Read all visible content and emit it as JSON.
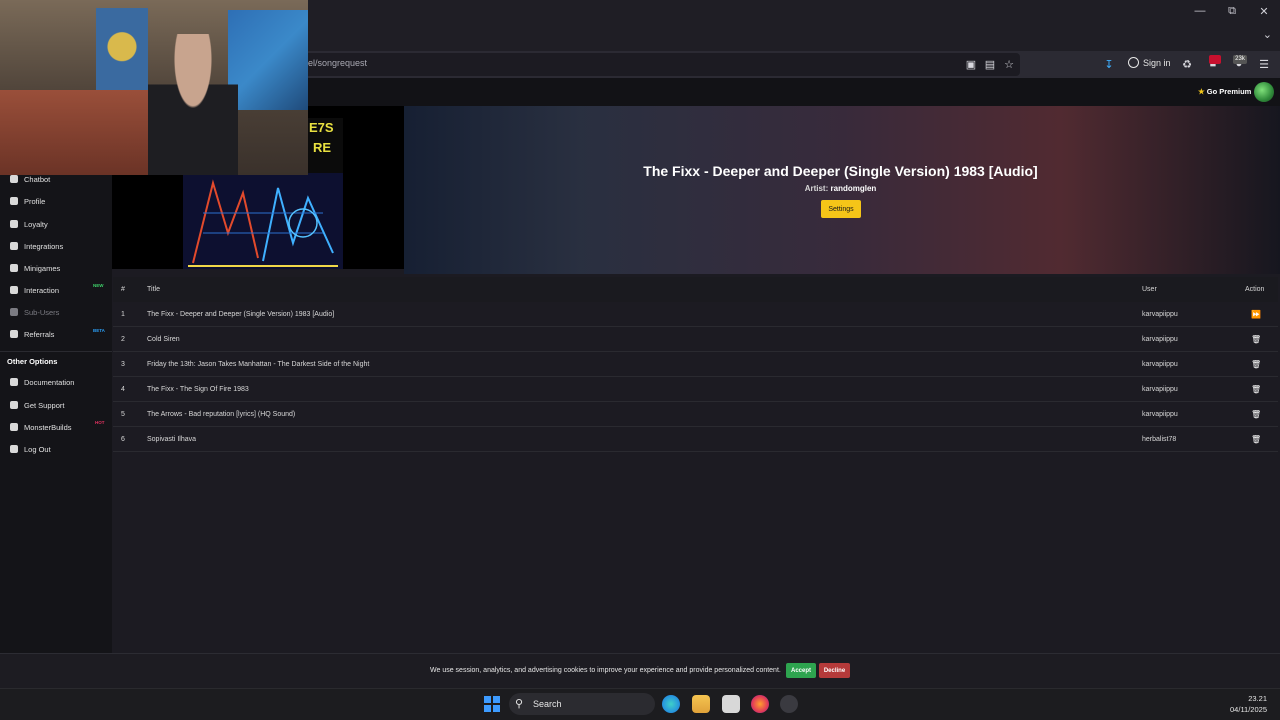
{
  "browser": {
    "url_partial": "el/songrequest",
    "sign_in_label": "Sign in",
    "ext_badge_count": "23k"
  },
  "header": {
    "premium_label": "Go Premium",
    "accent_color": "#f0c419"
  },
  "sidebar": {
    "items": [
      {
        "label": "Chatbot",
        "icon": "chatbot-icon"
      },
      {
        "label": "Profile",
        "icon": "profile-icon"
      },
      {
        "label": "Loyalty",
        "icon": "trophy-icon"
      },
      {
        "label": "Integrations",
        "icon": "integrations-icon"
      },
      {
        "label": "Minigames",
        "icon": "gamepad-icon"
      },
      {
        "label": "Interaction",
        "icon": "bell-icon",
        "tag": "NEW"
      },
      {
        "label": "Sub-Users",
        "icon": "subusers-icon"
      },
      {
        "label": "Referrals",
        "icon": "referrals-icon",
        "tag": "BETA"
      }
    ],
    "other_heading": "Other Options",
    "other_items": [
      {
        "label": "Documentation",
        "icon": "document-icon"
      },
      {
        "label": "Get Support",
        "icon": "support-icon"
      },
      {
        "label": "MonsterBuilds",
        "icon": "computer-icon",
        "tag": "HOT"
      },
      {
        "label": "Log Out",
        "icon": "logout-icon"
      }
    ]
  },
  "now_playing": {
    "title": "The Fixx - Deeper and Deeper (Single Version) 1983 [Audio]",
    "artist_label": "Artist:",
    "artist": "randomglen",
    "settings_label": "Settings",
    "settings_color": "#f5c518"
  },
  "queue": {
    "headers": {
      "num": "#",
      "title": "Title",
      "user": "User",
      "action": "Action"
    },
    "rows": [
      {
        "num": "1",
        "title": "The Fixx - Deeper and Deeper (Single Version) 1983 [Audio]",
        "user": "karvapiippu",
        "action": "skip"
      },
      {
        "num": "2",
        "title": "Cold Siren",
        "user": "karvapiippu",
        "action": "delete"
      },
      {
        "num": "3",
        "title": "Friday the 13th: Jason Takes Manhattan - The Darkest Side of the Night",
        "user": "karvapiippu",
        "action": "delete"
      },
      {
        "num": "4",
        "title": "The Fixx - The Sign Of Fire 1983",
        "user": "karvapiippu",
        "action": "delete"
      },
      {
        "num": "5",
        "title": "The Arrows - Bad reputation [lyrics] (HQ Sound)",
        "user": "karvapiippu",
        "action": "delete"
      },
      {
        "num": "6",
        "title": "Sopivasti Ilhava",
        "user": "herbalist78",
        "action": "delete"
      }
    ]
  },
  "cookie": {
    "text": "We use session, analytics, and advertising cookies to improve your experience and provide personalized content.",
    "accept_label": "Accept",
    "decline_label": "Decline",
    "accept_color": "#2ea44f",
    "decline_color": "#b53a3a"
  },
  "taskbar": {
    "search_label": "Search",
    "time": "23.21",
    "date": "04/11/2025"
  }
}
